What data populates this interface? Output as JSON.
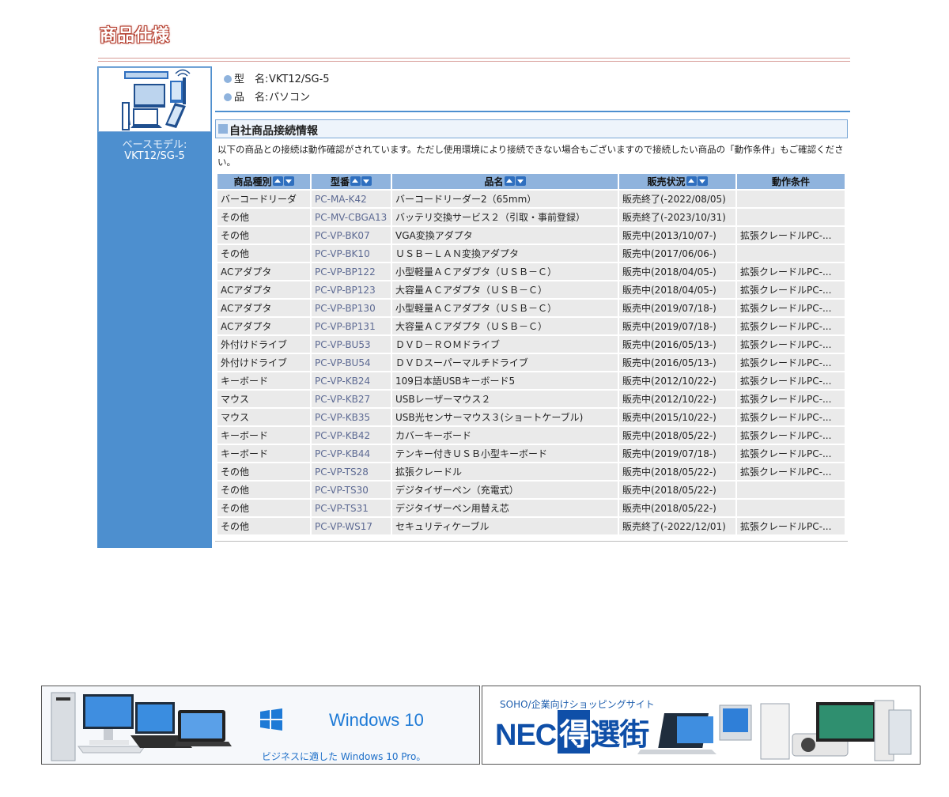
{
  "page": {
    "title": "商品仕様"
  },
  "left_panel": {
    "base_label": "ベースモデル:",
    "base_value": "VKT12/SG-5"
  },
  "info": {
    "model_label": "型　名:",
    "model_value": "VKT12/SG-5",
    "product_label": "品　名:",
    "product_value": "パソコン"
  },
  "section": {
    "title": "自社商品接続情報",
    "intro": "以下の商品との接続は動作確認がされています。ただし使用環境により接続できない場合もございますので接続したい商品の「動作条件」もご確認ください。"
  },
  "table": {
    "headers": [
      "商品種別",
      "型番",
      "品名",
      "販売状況",
      "動作条件"
    ],
    "rows": [
      [
        "バーコードリーダ",
        "PC-MA-K42",
        "バーコードリーダー2（65mm）",
        "販売終了(-2022/08/05)",
        ""
      ],
      [
        "その他",
        "PC-MV-CBGA13",
        "バッテリ交換サービス２（引取・事前登録）",
        "販売終了(-2023/10/31)",
        ""
      ],
      [
        "その他",
        "PC-VP-BK07",
        "VGA変換アダプタ",
        "販売中(2013/10/07-)",
        "拡張クレードルPC-..."
      ],
      [
        "その他",
        "PC-VP-BK10",
        "ＵＳＢ－ＬＡＮ変換アダプタ",
        "販売中(2017/06/06-)",
        ""
      ],
      [
        "ACアダプタ",
        "PC-VP-BP122",
        "小型軽量ＡＣアダプタ（ＵＳＢ－Ｃ）",
        "販売中(2018/04/05-)",
        "拡張クレードルPC-..."
      ],
      [
        "ACアダプタ",
        "PC-VP-BP123",
        "大容量ＡＣアダプタ（ＵＳＢ－Ｃ）",
        "販売中(2018/04/05-)",
        "拡張クレードルPC-..."
      ],
      [
        "ACアダプタ",
        "PC-VP-BP130",
        "小型軽量ＡＣアダプタ（ＵＳＢ－Ｃ）",
        "販売中(2019/07/18-)",
        "拡張クレードルPC-..."
      ],
      [
        "ACアダプタ",
        "PC-VP-BP131",
        "大容量ＡＣアダプタ（ＵＳＢ－Ｃ）",
        "販売中(2019/07/18-)",
        "拡張クレードルPC-..."
      ],
      [
        "外付けドライブ",
        "PC-VP-BU53",
        "ＤＶＤ－ＲＯＭドライブ",
        "販売中(2016/05/13-)",
        "拡張クレードルPC-..."
      ],
      [
        "外付けドライブ",
        "PC-VP-BU54",
        "ＤＶＤスーパーマルチドライブ",
        "販売中(2016/05/13-)",
        "拡張クレードルPC-..."
      ],
      [
        "キーボード",
        "PC-VP-KB24",
        "109日本語USBキーボード5",
        "販売中(2012/10/22-)",
        "拡張クレードルPC-..."
      ],
      [
        "マウス",
        "PC-VP-KB27",
        "USBレーザーマウス２",
        "販売中(2012/10/22-)",
        "拡張クレードルPC-..."
      ],
      [
        "マウス",
        "PC-VP-KB35",
        "USB光センサーマウス３(ショートケーブル)",
        "販売中(2015/10/22-)",
        "拡張クレードルPC-..."
      ],
      [
        "キーボード",
        "PC-VP-KB42",
        "カバーキーボード",
        "販売中(2018/05/22-)",
        "拡張クレードルPC-..."
      ],
      [
        "キーボード",
        "PC-VP-KB44",
        "テンキー付きＵＳＢ小型キーボード",
        "販売中(2019/07/18-)",
        "拡張クレードルPC-..."
      ],
      [
        "その他",
        "PC-VP-TS28",
        "拡張クレードル",
        "販売中(2018/05/22-)",
        "拡張クレードルPC-..."
      ],
      [
        "その他",
        "PC-VP-TS30",
        "デジタイザーペン（充電式）",
        "販売中(2018/05/22-)",
        ""
      ],
      [
        "その他",
        "PC-VP-TS31",
        "デジタイザーペン用替え芯",
        "販売中(2018/05/22-)",
        ""
      ],
      [
        "その他",
        "PC-VP-WS17",
        "セキュリティケーブル",
        "販売終了(-2022/12/01)",
        "拡張クレードルPC-..."
      ]
    ]
  },
  "banners": {
    "windows": {
      "logo_text": "Windows 10",
      "subtitle": "ビジネスに適した Windows 10 Pro。"
    },
    "nec": {
      "top_text": "SOHO/企業向けショッピングサイト",
      "logo_main": "NEC",
      "logo_boxed": "得",
      "logo_rest": "選街"
    }
  }
}
